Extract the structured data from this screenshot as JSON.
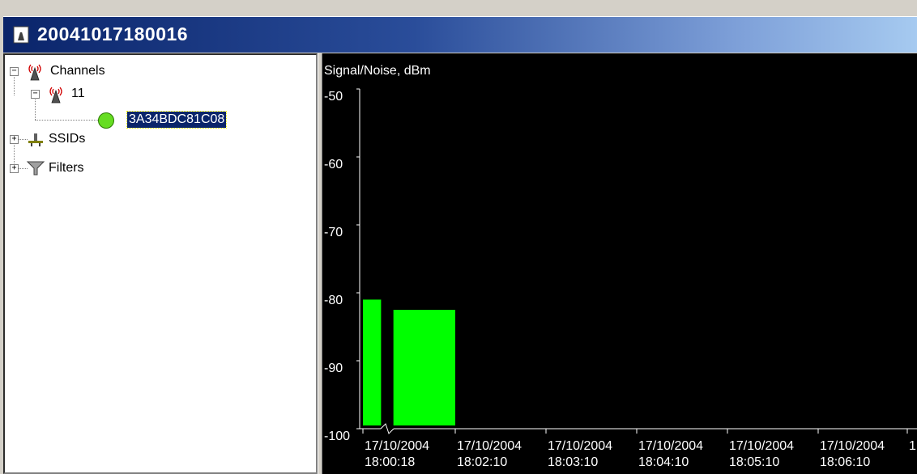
{
  "window": {
    "title": "20041017180016",
    "icon": "capture-document-icon"
  },
  "tree": {
    "items": [
      {
        "label": "Channels",
        "icon": "antenna-icon",
        "expander": "minus"
      },
      {
        "label": "11",
        "icon": "antenna-icon",
        "expander": "minus"
      },
      {
        "label": "3A34BDC81C08",
        "icon": "green-circle-icon",
        "selected": true
      },
      {
        "label": "SSIDs",
        "icon": "network-icon",
        "expander": "plus"
      },
      {
        "label": "Filters",
        "icon": "funnel-icon",
        "expander": "plus"
      }
    ]
  },
  "chart_data": {
    "type": "bar",
    "ylabel": "Signal/Noise, dBm",
    "ylim": [
      -100,
      -50
    ],
    "yticks": [
      "-50",
      "-60",
      "-70",
      "-80",
      "-90",
      "-100"
    ],
    "xticks": [
      [
        "17/10/2004",
        "18:00:18"
      ],
      [
        "17/10/2004",
        "18:02:10"
      ],
      [
        "17/10/2004",
        "18:03:10"
      ],
      [
        "17/10/2004",
        "18:04:10"
      ],
      [
        "17/10/2004",
        "18:05:10"
      ],
      [
        "17/10/2004",
        "18:06:10"
      ],
      [
        "1",
        ""
      ]
    ],
    "bars": [
      {
        "x_start": "18:00:18",
        "x_end": "18:00:40",
        "value": -81
      },
      {
        "x_start": "18:00:55",
        "x_end": "18:02:10",
        "value": -82.5
      }
    ],
    "bar_color": "#00ff00",
    "background": "#000000",
    "grid": false
  },
  "colors": {
    "titlebar_start": "#0a246a",
    "titlebar_end": "#a6caf0",
    "selection": "#0a246a",
    "node_green": "#66dd22"
  }
}
